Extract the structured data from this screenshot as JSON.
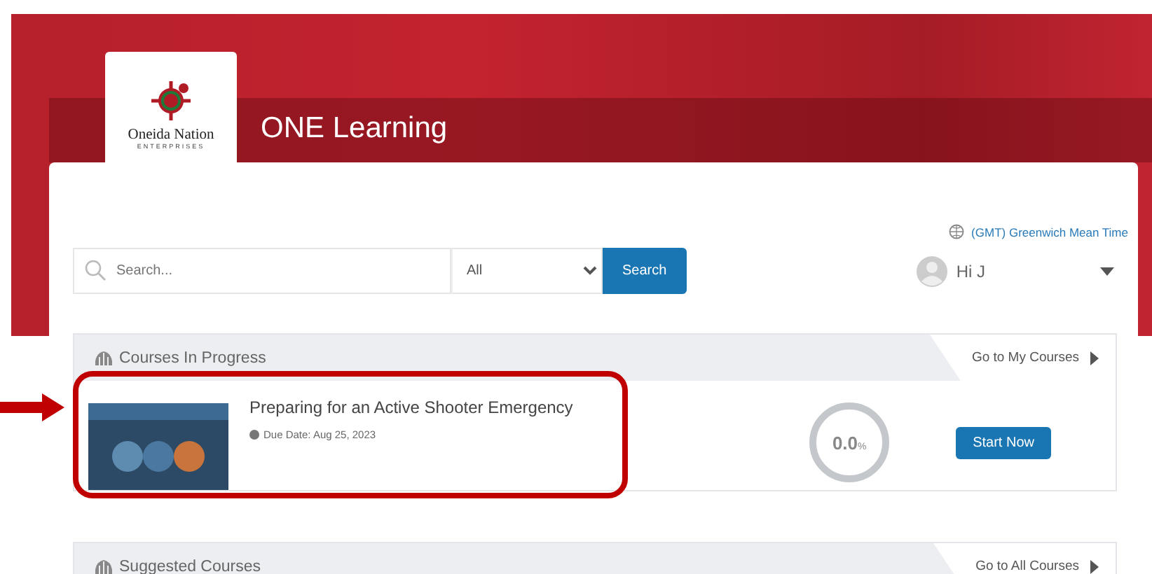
{
  "header": {
    "logo_name": "Oneida Nation",
    "logo_sub": "ENTERPRISES",
    "title": "ONE Learning"
  },
  "timezone": "(GMT) Greenwich Mean Time",
  "search": {
    "placeholder": "Search...",
    "filter": "All",
    "button": "Search"
  },
  "user": {
    "greeting": "Hi J"
  },
  "sections": [
    {
      "title": "Courses In Progress",
      "link": "Go to My Courses",
      "courses": [
        {
          "title": "Preparing for an Active Shooter Emergency",
          "due": "Due Date: Aug 25, 2023",
          "progress": "0.0",
          "unit": "%",
          "action": "Start Now"
        }
      ]
    },
    {
      "title": "Suggested Courses",
      "link": "Go to All Courses"
    }
  ]
}
